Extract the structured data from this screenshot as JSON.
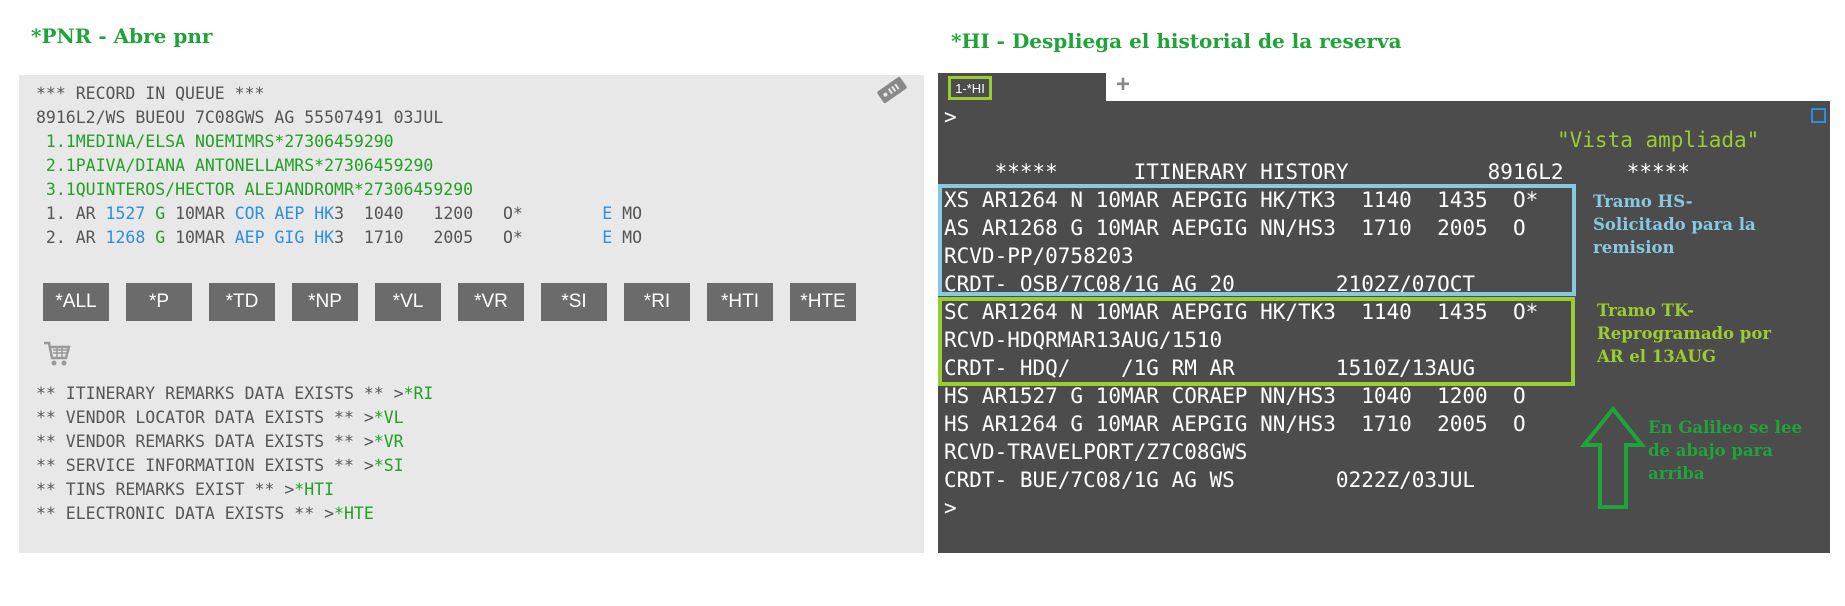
{
  "left_heading": "*PNR - Abre pnr",
  "right_heading": "*HI - Despliega el historial de la reserva",
  "pnr": {
    "l1": "*** RECORD IN QUEUE ***",
    "l2": "8916L2/WS BUEOU 7C08GWS AG 55507491 03JUL",
    "pax1": " 1.1MEDINA/ELSA NOEMIMRS*27306459290",
    "pax2": " 2.1PAIVA/DIANA ANTONELLAMRS*27306459290",
    "pax3": " 3.1QUINTEROS/HECTOR ALEJANDROMR*27306459290",
    "seg1": {
      "num": " 1. AR ",
      "flight": "1527",
      "cls": " G ",
      "date": "10MAR ",
      "route": "COR AEP",
      "status": " HK",
      "rest": "3  1040   1200   O*        ",
      "e": "E",
      "day": " MO"
    },
    "seg2": {
      "num": " 2. AR ",
      "flight": "1268",
      "cls": " G ",
      "date": "10MAR ",
      "route": "AEP GIG",
      "status": " HK",
      "rest": "3  1710   2005   O*        ",
      "e": "E",
      "day": " MO"
    },
    "buttons": [
      "*ALL",
      "*P",
      "*TD",
      "*NP",
      "*VL",
      "*VR",
      "*SI",
      "*RI",
      "*HTI",
      "*HTE"
    ],
    "remarks": [
      {
        "text": "** ITINERARY REMARKS DATA EXISTS ** >",
        "cmd": "*RI"
      },
      {
        "text": "** VENDOR LOCATOR DATA EXISTS ** >",
        "cmd": "*VL"
      },
      {
        "text": "** VENDOR REMARKS DATA EXISTS ** >",
        "cmd": "*VR"
      },
      {
        "text": "** SERVICE INFORMATION EXISTS ** >",
        "cmd": "*SI"
      },
      {
        "text": "** TINS REMARKS EXIST ** >",
        "cmd": "*HTI"
      },
      {
        "text": "** ELECTRONIC DATA EXISTS ** >",
        "cmd": "*HTE"
      }
    ]
  },
  "hi": {
    "tab_label": "1-*HI",
    "add_tab": "+",
    "prompt_top": ">",
    "vista": "\"Vista ampliada\"",
    "header": "    *****      ITINERARY HISTORY           8916L2     *****",
    "lines": [
      "XS AR1264 N 10MAR AEPGIG HK/TK3  1140  1435  O*",
      "AS AR1268 G 10MAR AEPGIG NN/HS3  1710  2005  O",
      "RCVD-PP/0758203",
      "CRDT- OSB/7C08/1G AG 20        2102Z/07OCT",
      "SC AR1264 N 10MAR AEPGIG HK/TK3  1140  1435  O*",
      "RCVD-HDQRMAR13AUG/1510",
      "CRDT- HDQ/    /1G RM AR        1510Z/13AUG",
      "HS AR1527 G 10MAR CORAEP NN/HS3  1040  1200  O",
      "HS AR1264 G 10MAR AEPGIG NN/HS3  1710  2005  O",
      "RCVD-TRAVELPORT/Z7C08GWS",
      "CRDT- BUE/7C08/1G AG WS        0222Z/03JUL"
    ],
    "prompt_bottom": ">"
  },
  "notes": {
    "hs": "Tramo HS- Solicitado para la remision",
    "tk": "Tramo TK- Reprogramado por AR el 13AUG",
    "galileo": "En Galileo se lee de abajo para arriba"
  },
  "colors": {
    "heading": "#1fa43a",
    "pnr_green": "#21a024",
    "pnr_blue": "#2c8ee0",
    "hs_box": "#87c9e3",
    "tk_box": "#9acd32",
    "arrow": "#1fa43a"
  }
}
